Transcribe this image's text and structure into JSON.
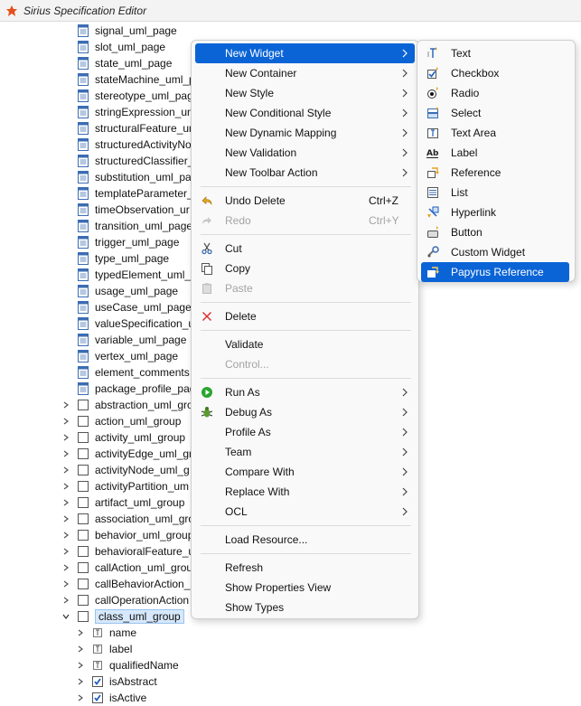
{
  "window": {
    "title": "Sirius Specification Editor"
  },
  "tree": {
    "pages": [
      "signal_uml_page",
      "slot_uml_page",
      "state_uml_page",
      "stateMachine_uml_p",
      "stereotype_uml_pag",
      "stringExpression_um",
      "structuralFeature_ur",
      "structuredActivityNo",
      "structuredClassifier_",
      "substitution_uml_pa",
      "templateParameter_",
      "timeObservation_ur",
      "transition_uml_page",
      "trigger_uml_page",
      "type_uml_page",
      "typedElement_uml_",
      "usage_uml_page",
      "useCase_uml_page",
      "valueSpecification_u",
      "variable_uml_page",
      "vertex_uml_page",
      "element_comments",
      "package_profile_pag"
    ],
    "groups": [
      "abstraction_uml_gro",
      "action_uml_group",
      "activity_uml_group",
      "activityEdge_uml_gr",
      "activityNode_uml_g",
      "activityPartition_um",
      "artifact_uml_group",
      "association_uml_gro",
      "behavior_uml_group",
      "behavioralFeature_u",
      "callAction_uml_grou",
      "callBehaviorAction_",
      "callOperationAction"
    ],
    "selected_group": "class_uml_group",
    "children": [
      {
        "label": "name",
        "icon": "text-field-icon"
      },
      {
        "label": "label",
        "icon": "text-field-icon"
      },
      {
        "label": "qualifiedName",
        "icon": "text-field-icon"
      },
      {
        "label": "isAbstract",
        "icon": "checkbox-icon"
      },
      {
        "label": "isActive",
        "icon": "checkbox-icon"
      }
    ]
  },
  "context_menu": {
    "items": [
      {
        "label": "New Widget",
        "submenu": true,
        "highlighted": true
      },
      {
        "label": "New Container",
        "submenu": true
      },
      {
        "label": "New Style",
        "submenu": true
      },
      {
        "label": "New Conditional Style",
        "submenu": true
      },
      {
        "label": "New Dynamic Mapping",
        "submenu": true
      },
      {
        "label": "New Validation",
        "submenu": true
      },
      {
        "label": "New Toolbar Action",
        "submenu": true
      },
      {
        "label": "Undo Delete",
        "shortcut": "Ctrl+Z",
        "icon": "undo-icon"
      },
      {
        "label": "Redo",
        "shortcut": "Ctrl+Y",
        "icon": "redo-icon",
        "disabled": true
      },
      {
        "label": "Cut",
        "icon": "cut-icon"
      },
      {
        "label": "Copy",
        "icon": "copy-icon"
      },
      {
        "label": "Paste",
        "icon": "paste-icon",
        "disabled": true
      },
      {
        "label": "Delete",
        "icon": "delete-icon"
      },
      {
        "label": "Validate"
      },
      {
        "label": "Control...",
        "disabled": true
      },
      {
        "label": "Run As",
        "submenu": true,
        "icon": "run-icon"
      },
      {
        "label": "Debug As",
        "submenu": true,
        "icon": "debug-icon"
      },
      {
        "label": "Profile As",
        "submenu": true
      },
      {
        "label": "Team",
        "submenu": true
      },
      {
        "label": "Compare With",
        "submenu": true
      },
      {
        "label": "Replace With",
        "submenu": true
      },
      {
        "label": "OCL",
        "submenu": true
      },
      {
        "label": "Load Resource..."
      },
      {
        "label": "Refresh"
      },
      {
        "label": "Show Properties View"
      },
      {
        "label": "Show Types"
      }
    ]
  },
  "widget_submenu": {
    "items": [
      {
        "label": "Text",
        "icon": "text-widget-icon"
      },
      {
        "label": "Checkbox",
        "icon": "checkbox-widget-icon"
      },
      {
        "label": "Radio",
        "icon": "radio-widget-icon"
      },
      {
        "label": "Select",
        "icon": "select-widget-icon"
      },
      {
        "label": "Text Area",
        "icon": "text-area-widget-icon"
      },
      {
        "label": "Label",
        "icon": "label-widget-icon"
      },
      {
        "label": "Reference",
        "icon": "reference-widget-icon"
      },
      {
        "label": "List",
        "icon": "list-widget-icon"
      },
      {
        "label": "Hyperlink",
        "icon": "hyperlink-widget-icon"
      },
      {
        "label": "Button",
        "icon": "button-widget-icon"
      },
      {
        "label": "Custom Widget",
        "icon": "custom-widget-icon"
      },
      {
        "label": "Papyrus Reference",
        "icon": "papyrus-reference-icon",
        "highlighted": true
      }
    ]
  },
  "colors": {
    "highlight": "#0a64d6",
    "selection_bg": "#d6e8fb",
    "menu_bg": "#f9f9f9"
  }
}
